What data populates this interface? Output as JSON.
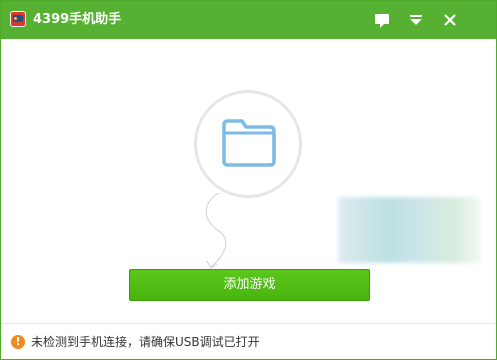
{
  "app": {
    "title": "4399手机助手",
    "accent_color": "#56b132",
    "logo_icon": "4399-app-logo"
  },
  "titlebar": {
    "buttons": [
      {
        "icon": "feedback-icon"
      },
      {
        "icon": "dropdown-menu-icon"
      },
      {
        "icon": "close-icon"
      }
    ]
  },
  "main": {
    "empty_state_icon": "folder-icon",
    "add_game_label": "添加游戏",
    "button_color": "#52bd14"
  },
  "status": {
    "icon": "warning-icon",
    "icon_glyph": "!",
    "message": "未检测到手机连接，请确保USB调试已打开",
    "icon_color": "#f08a24"
  }
}
